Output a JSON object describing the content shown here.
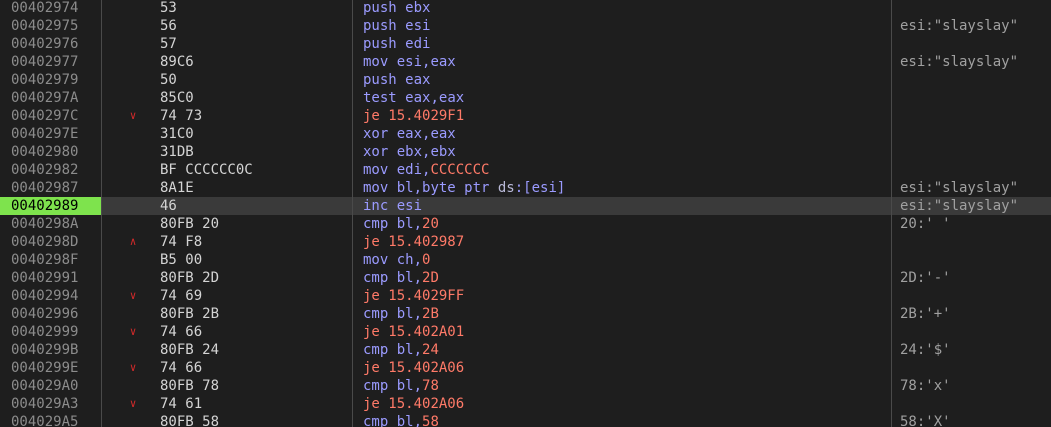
{
  "colors": {
    "background": "#1e1e1e",
    "selected_address_bg": "#7ee34d",
    "selected_row_bg": "#3a3a3a",
    "mnemonic": "#9b9bff",
    "jump_mnemonic": "#ff7a68",
    "immediate": "#ff7a68",
    "branch_arrow": "#d12a2a"
  },
  "selected_index": 11,
  "rows": [
    {
      "addr": "00402974",
      "arrow": "",
      "bytes": "53",
      "mn": "push",
      "jmp": false,
      "ops": [
        {
          "t": "ebx",
          "k": "reg"
        }
      ],
      "comment": ""
    },
    {
      "addr": "00402975",
      "arrow": "",
      "bytes": "56",
      "mn": "push",
      "jmp": false,
      "ops": [
        {
          "t": "esi",
          "k": "reg"
        }
      ],
      "comment": "esi:\"slayslay\""
    },
    {
      "addr": "00402976",
      "arrow": "",
      "bytes": "57",
      "mn": "push",
      "jmp": false,
      "ops": [
        {
          "t": "edi",
          "k": "reg"
        }
      ],
      "comment": ""
    },
    {
      "addr": "00402977",
      "arrow": "",
      "bytes": "89C6",
      "mn": "mov",
      "jmp": false,
      "ops": [
        {
          "t": "esi",
          "k": "reg"
        },
        {
          "t": ",",
          "k": "reg"
        },
        {
          "t": "eax",
          "k": "reg"
        }
      ],
      "comment": "esi:\"slayslay\""
    },
    {
      "addr": "00402979",
      "arrow": "",
      "bytes": "50",
      "mn": "push",
      "jmp": false,
      "ops": [
        {
          "t": "eax",
          "k": "reg"
        }
      ],
      "comment": ""
    },
    {
      "addr": "0040297A",
      "arrow": "",
      "bytes": "85C0",
      "mn": "test",
      "jmp": false,
      "ops": [
        {
          "t": "eax",
          "k": "reg"
        },
        {
          "t": ",",
          "k": "reg"
        },
        {
          "t": "eax",
          "k": "reg"
        }
      ],
      "comment": ""
    },
    {
      "addr": "0040297C",
      "arrow": "down",
      "bytes": "74 73",
      "mn": "je",
      "jmp": true,
      "ops": [
        {
          "t": "15.4029F1",
          "k": "imm"
        }
      ],
      "comment": ""
    },
    {
      "addr": "0040297E",
      "arrow": "",
      "bytes": "31C0",
      "mn": "xor",
      "jmp": false,
      "ops": [
        {
          "t": "eax",
          "k": "reg"
        },
        {
          "t": ",",
          "k": "reg"
        },
        {
          "t": "eax",
          "k": "reg"
        }
      ],
      "comment": ""
    },
    {
      "addr": "00402980",
      "arrow": "",
      "bytes": "31DB",
      "mn": "xor",
      "jmp": false,
      "ops": [
        {
          "t": "ebx",
          "k": "reg"
        },
        {
          "t": ",",
          "k": "reg"
        },
        {
          "t": "ebx",
          "k": "reg"
        }
      ],
      "comment": ""
    },
    {
      "addr": "00402982",
      "arrow": "",
      "bytes": "BF CCCCCC0C",
      "mn": "mov",
      "jmp": false,
      "ops": [
        {
          "t": "edi",
          "k": "reg"
        },
        {
          "t": ",",
          "k": "reg"
        },
        {
          "t": "CCCCCCC",
          "k": "imm"
        }
      ],
      "comment": ""
    },
    {
      "addr": "00402987",
      "arrow": "",
      "bytes": "8A1E",
      "mn": "mov",
      "jmp": false,
      "ops": [
        {
          "t": "bl",
          "k": "reg"
        },
        {
          "t": ",",
          "k": "reg"
        },
        {
          "t": "byte ptr ",
          "k": "reg"
        },
        {
          "t": "ds",
          "k": "ptr"
        },
        {
          "t": ":[",
          "k": "reg"
        },
        {
          "t": "esi",
          "k": "reg"
        },
        {
          "t": "]",
          "k": "reg"
        }
      ],
      "comment": "esi:\"slayslay\""
    },
    {
      "addr": "00402989",
      "arrow": "",
      "bytes": "46",
      "mn": "inc",
      "jmp": false,
      "ops": [
        {
          "t": "esi",
          "k": "reg"
        }
      ],
      "comment": "esi:\"slayslay\""
    },
    {
      "addr": "0040298A",
      "arrow": "",
      "bytes": "80FB 20",
      "mn": "cmp",
      "jmp": false,
      "ops": [
        {
          "t": "bl",
          "k": "reg"
        },
        {
          "t": ",",
          "k": "reg"
        },
        {
          "t": "20",
          "k": "imm"
        }
      ],
      "comment": "20:' '"
    },
    {
      "addr": "0040298D",
      "arrow": "up",
      "bytes": "74 F8",
      "mn": "je",
      "jmp": true,
      "ops": [
        {
          "t": "15.402987",
          "k": "imm"
        }
      ],
      "comment": ""
    },
    {
      "addr": "0040298F",
      "arrow": "",
      "bytes": "B5 00",
      "mn": "mov",
      "jmp": false,
      "ops": [
        {
          "t": "ch",
          "k": "reg"
        },
        {
          "t": ",",
          "k": "reg"
        },
        {
          "t": "0",
          "k": "imm"
        }
      ],
      "comment": ""
    },
    {
      "addr": "00402991",
      "arrow": "",
      "bytes": "80FB 2D",
      "mn": "cmp",
      "jmp": false,
      "ops": [
        {
          "t": "bl",
          "k": "reg"
        },
        {
          "t": ",",
          "k": "reg"
        },
        {
          "t": "2D",
          "k": "imm"
        }
      ],
      "comment": "2D:'-'"
    },
    {
      "addr": "00402994",
      "arrow": "down",
      "bytes": "74 69",
      "mn": "je",
      "jmp": true,
      "ops": [
        {
          "t": "15.4029FF",
          "k": "imm"
        }
      ],
      "comment": ""
    },
    {
      "addr": "00402996",
      "arrow": "",
      "bytes": "80FB 2B",
      "mn": "cmp",
      "jmp": false,
      "ops": [
        {
          "t": "bl",
          "k": "reg"
        },
        {
          "t": ",",
          "k": "reg"
        },
        {
          "t": "2B",
          "k": "imm"
        }
      ],
      "comment": "2B:'+'"
    },
    {
      "addr": "00402999",
      "arrow": "down",
      "bytes": "74 66",
      "mn": "je",
      "jmp": true,
      "ops": [
        {
          "t": "15.402A01",
          "k": "imm"
        }
      ],
      "comment": ""
    },
    {
      "addr": "0040299B",
      "arrow": "",
      "bytes": "80FB 24",
      "mn": "cmp",
      "jmp": false,
      "ops": [
        {
          "t": "bl",
          "k": "reg"
        },
        {
          "t": ",",
          "k": "reg"
        },
        {
          "t": "24",
          "k": "imm"
        }
      ],
      "comment": "24:'$'"
    },
    {
      "addr": "0040299E",
      "arrow": "down",
      "bytes": "74 66",
      "mn": "je",
      "jmp": true,
      "ops": [
        {
          "t": "15.402A06",
          "k": "imm"
        }
      ],
      "comment": ""
    },
    {
      "addr": "004029A0",
      "arrow": "",
      "bytes": "80FB 78",
      "mn": "cmp",
      "jmp": false,
      "ops": [
        {
          "t": "bl",
          "k": "reg"
        },
        {
          "t": ",",
          "k": "reg"
        },
        {
          "t": "78",
          "k": "imm"
        }
      ],
      "comment": "78:'x'"
    },
    {
      "addr": "004029A3",
      "arrow": "down",
      "bytes": "74 61",
      "mn": "je",
      "jmp": true,
      "ops": [
        {
          "t": "15.402A06",
          "k": "imm"
        }
      ],
      "comment": ""
    },
    {
      "addr": "004029A5",
      "arrow": "",
      "bytes": "80FB 58",
      "mn": "cmp",
      "jmp": false,
      "ops": [
        {
          "t": "bl",
          "k": "reg"
        },
        {
          "t": ",",
          "k": "reg"
        },
        {
          "t": "58",
          "k": "imm"
        }
      ],
      "comment": "58:'X'"
    }
  ]
}
